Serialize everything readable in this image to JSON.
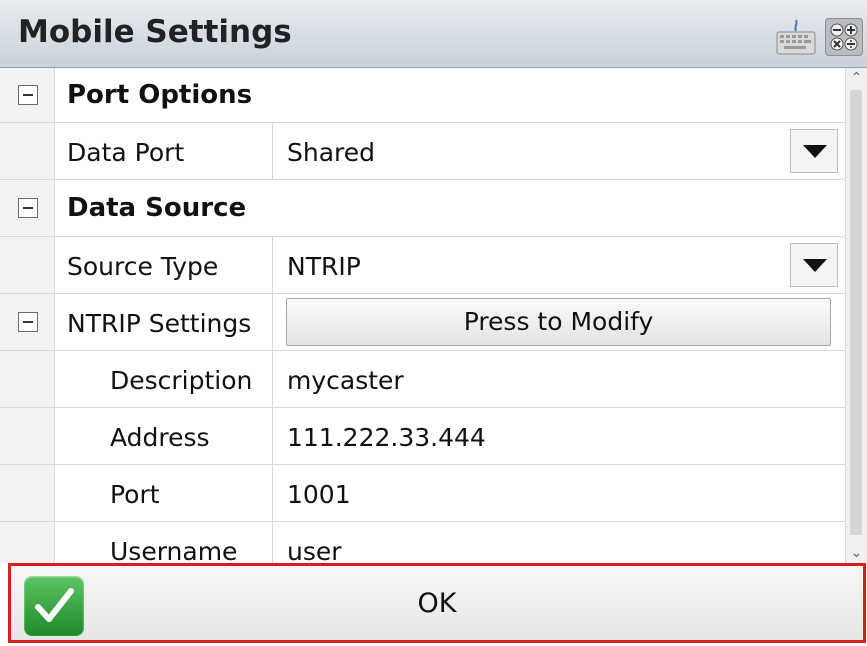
{
  "window": {
    "title": "Mobile Settings"
  },
  "icons": {
    "keyboard": "keyboard-icon",
    "calculator": "calculator-icon",
    "ok": "checkmark-icon"
  },
  "sections": {
    "port_options": {
      "label": "Port Options"
    },
    "data_source": {
      "label": "Data Source"
    }
  },
  "properties": {
    "data_port": {
      "label": "Data Port",
      "value": "Shared"
    },
    "source_type": {
      "label": "Source Type",
      "value": "NTRIP"
    },
    "ntrip_settings": {
      "label": "NTRIP Settings",
      "button": "Press to Modify"
    },
    "description": {
      "label": "Description",
      "value": "mycaster"
    },
    "address": {
      "label": "Address",
      "value": "111.222.33.444"
    },
    "port": {
      "label": "Port",
      "value": "1001"
    },
    "username": {
      "label": "Username",
      "value": "user"
    }
  },
  "footer": {
    "ok_label": "OK"
  },
  "colors": {
    "highlight_border": "#d21f1f",
    "ok_green": "#2e9a36"
  }
}
